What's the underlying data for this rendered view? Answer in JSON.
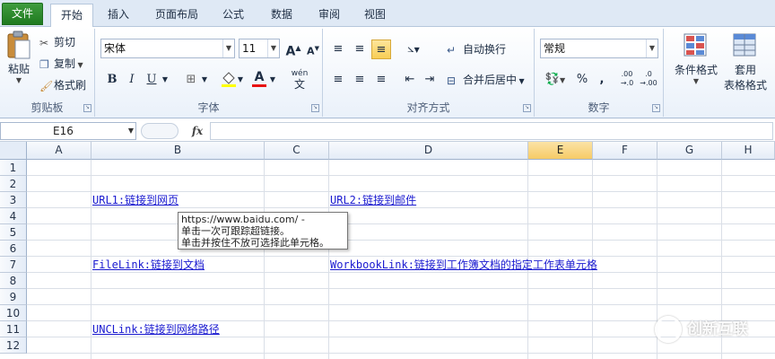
{
  "tabs": [
    {
      "label": "文件",
      "kind": "file"
    },
    {
      "label": "开始",
      "kind": "active"
    },
    {
      "label": "插入"
    },
    {
      "label": "页面布局"
    },
    {
      "label": "公式"
    },
    {
      "label": "数据"
    },
    {
      "label": "审阅"
    },
    {
      "label": "视图"
    }
  ],
  "ribbon": {
    "clipboard": {
      "label": "剪贴板",
      "paste": "粘贴",
      "cut": "剪切",
      "copy": "复制",
      "format_painter": "格式刷"
    },
    "font": {
      "label": "字体",
      "font_name": "宋体",
      "font_size": "11",
      "bold": "B",
      "italic": "I",
      "underline": "U",
      "grow": "A",
      "shrink": "A",
      "font_color_letter": "A",
      "phonetic": "wén"
    },
    "alignment": {
      "label": "对齐方式",
      "wrap_text": "自动换行",
      "merge_center": "合并后居中"
    },
    "number": {
      "label": "数字",
      "format": "常规",
      "percent": "%",
      "comma": ",",
      "inc_decimal": ".00",
      "dec_decimal": ".0"
    },
    "styles": {
      "conditional": "条件格式",
      "table_format_1": "套用",
      "table_format_2": "表格格式"
    }
  },
  "formula_bar": {
    "name_box": "E16",
    "fx": "fx",
    "value": ""
  },
  "columns": [
    {
      "label": "A"
    },
    {
      "label": "B"
    },
    {
      "label": "C"
    },
    {
      "label": "D"
    },
    {
      "label": "E",
      "selected": true
    },
    {
      "label": "F"
    },
    {
      "label": "G"
    },
    {
      "label": "H"
    }
  ],
  "rows": [
    "1",
    "2",
    "3",
    "4",
    "5",
    "6",
    "7",
    "8",
    "9",
    "10",
    "11",
    "12"
  ],
  "cells": {
    "b3": "URL1:链接到网页",
    "d3": "URL2:链接到邮件",
    "b7": "FileLink:链接到文档",
    "d7": "WorkbookLink:链接到工作簿文档的指定工作表单元格",
    "b11": "UNCLink:链接到网络路径"
  },
  "tooltip": {
    "line1": "https://www.baidu.com/ -",
    "line2": "单击一次可跟踪超链接。",
    "line3": "单击并按住不放可选择此单元格。"
  },
  "watermark": {
    "text": "创新互联"
  },
  "colors": {
    "link": "#1a1ad0",
    "file_tab": "#2e8b2e",
    "selected_header": "#f8d27a"
  }
}
